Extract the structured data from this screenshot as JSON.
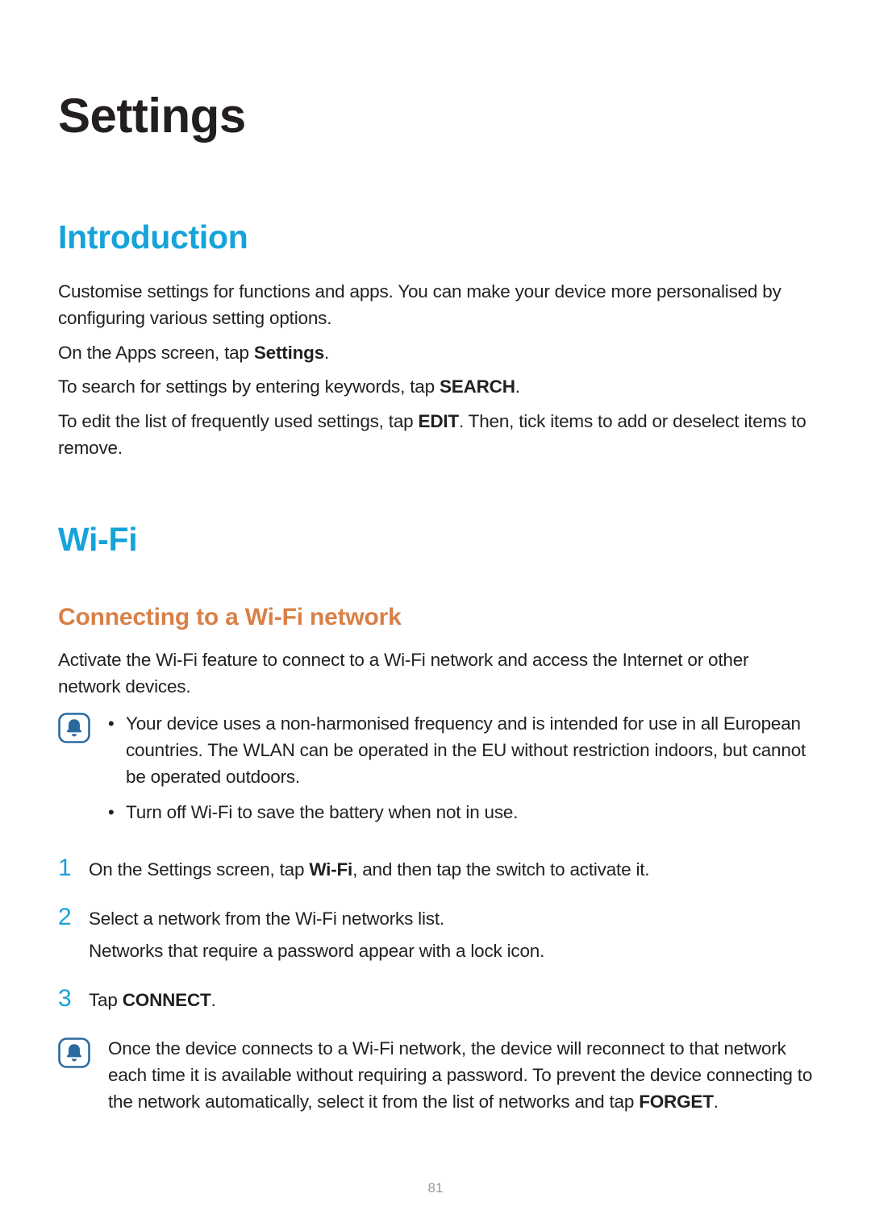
{
  "title": "Settings",
  "sections": {
    "intro": {
      "heading": "Introduction",
      "p1": "Customise settings for functions and apps. You can make your device more personalised by configuring various setting options.",
      "p2_pre": "On the Apps screen, tap ",
      "p2_bold": "Settings",
      "p2_post": ".",
      "p3_pre": "To search for settings by entering keywords, tap ",
      "p3_bold": "SEARCH",
      "p3_post": ".",
      "p4_pre": "To edit the list of frequently used settings, tap ",
      "p4_bold": "EDIT",
      "p4_post": ". Then, tick items to add or deselect items to remove."
    },
    "wifi": {
      "heading": "Wi-Fi",
      "subheading": "Connecting to a Wi-Fi network",
      "p1": "Activate the Wi-Fi feature to connect to a Wi-Fi network and access the Internet or other network devices.",
      "note1": {
        "b1": "Your device uses a non-harmonised frequency and is intended for use in all European countries. The WLAN can be operated in the EU without restriction indoors, but cannot be operated outdoors.",
        "b2": "Turn off Wi-Fi to save the battery when not in use."
      },
      "steps": {
        "s1_pre": "On the Settings screen, tap ",
        "s1_bold": "Wi-Fi",
        "s1_post": ", and then tap the switch to activate it.",
        "s2a": "Select a network from the Wi-Fi networks list.",
        "s2b": "Networks that require a password appear with a lock icon.",
        "s3_pre": "Tap ",
        "s3_bold": "CONNECT",
        "s3_post": "."
      },
      "note2_pre": "Once the device connects to a Wi-Fi network, the device will reconnect to that network each time it is available without requiring a password. To prevent the device connecting to the network automatically, select it from the list of networks and tap ",
      "note2_bold": "FORGET",
      "note2_post": "."
    }
  },
  "stepNumbers": {
    "n1": "1",
    "n2": "2",
    "n3": "3"
  },
  "pageNumber": "81",
  "colors": {
    "accent": "#15a3da",
    "sub": "#d98047",
    "text": "#231f20"
  }
}
